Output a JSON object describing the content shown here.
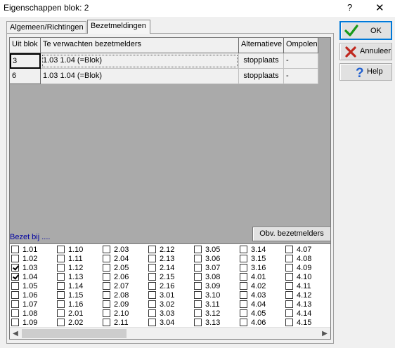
{
  "window": {
    "title": "Eigenschappen blok: 2",
    "help_symbol": "?",
    "close_symbol": "✕"
  },
  "tabs": [
    {
      "label": "Algemeen/Richtingen"
    },
    {
      "label": "Bezetmeldingen"
    }
  ],
  "grid": {
    "headers": [
      "Uit blok",
      "Te verwachten bezetmelders",
      "Alternatieve",
      "Ompolen"
    ],
    "rows": [
      [
        "3",
        "1.03  1.04 (=Blok)",
        "stopplaats",
        "-"
      ],
      [
        "6",
        "1.03  1.04 (=Blok)",
        "stopplaats",
        "-"
      ]
    ]
  },
  "bezet_label": "Bezet bij ....",
  "obv_button": "Obv. bezetmelders",
  "checklist": [
    [
      {
        "label": "1.01",
        "checked": false
      },
      {
        "label": "1.02",
        "checked": false
      },
      {
        "label": "1.03",
        "checked": true
      },
      {
        "label": "1.04",
        "checked": true
      },
      {
        "label": "1.05",
        "checked": false
      },
      {
        "label": "1.06",
        "checked": false
      },
      {
        "label": "1.07",
        "checked": false
      },
      {
        "label": "1.08",
        "checked": false
      },
      {
        "label": "1.09",
        "checked": false
      }
    ],
    [
      {
        "label": "1.10",
        "checked": false
      },
      {
        "label": "1.11",
        "checked": false
      },
      {
        "label": "1.12",
        "checked": false
      },
      {
        "label": "1.13",
        "checked": false
      },
      {
        "label": "1.14",
        "checked": false
      },
      {
        "label": "1.15",
        "checked": false
      },
      {
        "label": "1.16",
        "checked": false
      },
      {
        "label": "2.01",
        "checked": false
      },
      {
        "label": "2.02",
        "checked": false
      }
    ],
    [
      {
        "label": "2.03",
        "checked": false
      },
      {
        "label": "2.04",
        "checked": false
      },
      {
        "label": "2.05",
        "checked": false
      },
      {
        "label": "2.06",
        "checked": false
      },
      {
        "label": "2.07",
        "checked": false
      },
      {
        "label": "2.08",
        "checked": false
      },
      {
        "label": "2.09",
        "checked": false
      },
      {
        "label": "2.10",
        "checked": false
      },
      {
        "label": "2.11",
        "checked": false
      }
    ],
    [
      {
        "label": "2.12",
        "checked": false
      },
      {
        "label": "2.13",
        "checked": false
      },
      {
        "label": "2.14",
        "checked": false
      },
      {
        "label": "2.15",
        "checked": false
      },
      {
        "label": "2.16",
        "checked": false
      },
      {
        "label": "3.01",
        "checked": false
      },
      {
        "label": "3.02",
        "checked": false
      },
      {
        "label": "3.03",
        "checked": false
      },
      {
        "label": "3.04",
        "checked": false
      }
    ],
    [
      {
        "label": "3.05",
        "checked": false
      },
      {
        "label": "3.06",
        "checked": false
      },
      {
        "label": "3.07",
        "checked": false
      },
      {
        "label": "3.08",
        "checked": false
      },
      {
        "label": "3.09",
        "checked": false
      },
      {
        "label": "3.10",
        "checked": false
      },
      {
        "label": "3.11",
        "checked": false
      },
      {
        "label": "3.12",
        "checked": false
      },
      {
        "label": "3.13",
        "checked": false
      }
    ],
    [
      {
        "label": "3.14",
        "checked": false
      },
      {
        "label": "3.15",
        "checked": false
      },
      {
        "label": "3.16",
        "checked": false
      },
      {
        "label": "4.01",
        "checked": false
      },
      {
        "label": "4.02",
        "checked": false
      },
      {
        "label": "4.03",
        "checked": false
      },
      {
        "label": "4.04",
        "checked": false
      },
      {
        "label": "4.05",
        "checked": false
      },
      {
        "label": "4.06",
        "checked": false
      }
    ],
    [
      {
        "label": "4.07",
        "checked": false
      },
      {
        "label": "4.08",
        "checked": false
      },
      {
        "label": "4.09",
        "checked": false
      },
      {
        "label": "4.10",
        "checked": false
      },
      {
        "label": "4.11",
        "checked": false
      },
      {
        "label": "4.12",
        "checked": false
      },
      {
        "label": "4.13",
        "checked": false
      },
      {
        "label": "4.14",
        "checked": false
      },
      {
        "label": "4.15",
        "checked": false
      }
    ]
  ],
  "buttons": {
    "ok": "OK",
    "cancel": "Annuleer",
    "help": "Help"
  },
  "icons": {
    "ok": "checkmark-icon",
    "cancel": "x-icon",
    "help": "question-icon"
  },
  "colors": {
    "ok_check": "#1a9a1a",
    "cancel_x": "#c0281e",
    "help_q": "#1f5fd0",
    "link_label": "#0000a0",
    "ok_border": "#0078d7"
  }
}
